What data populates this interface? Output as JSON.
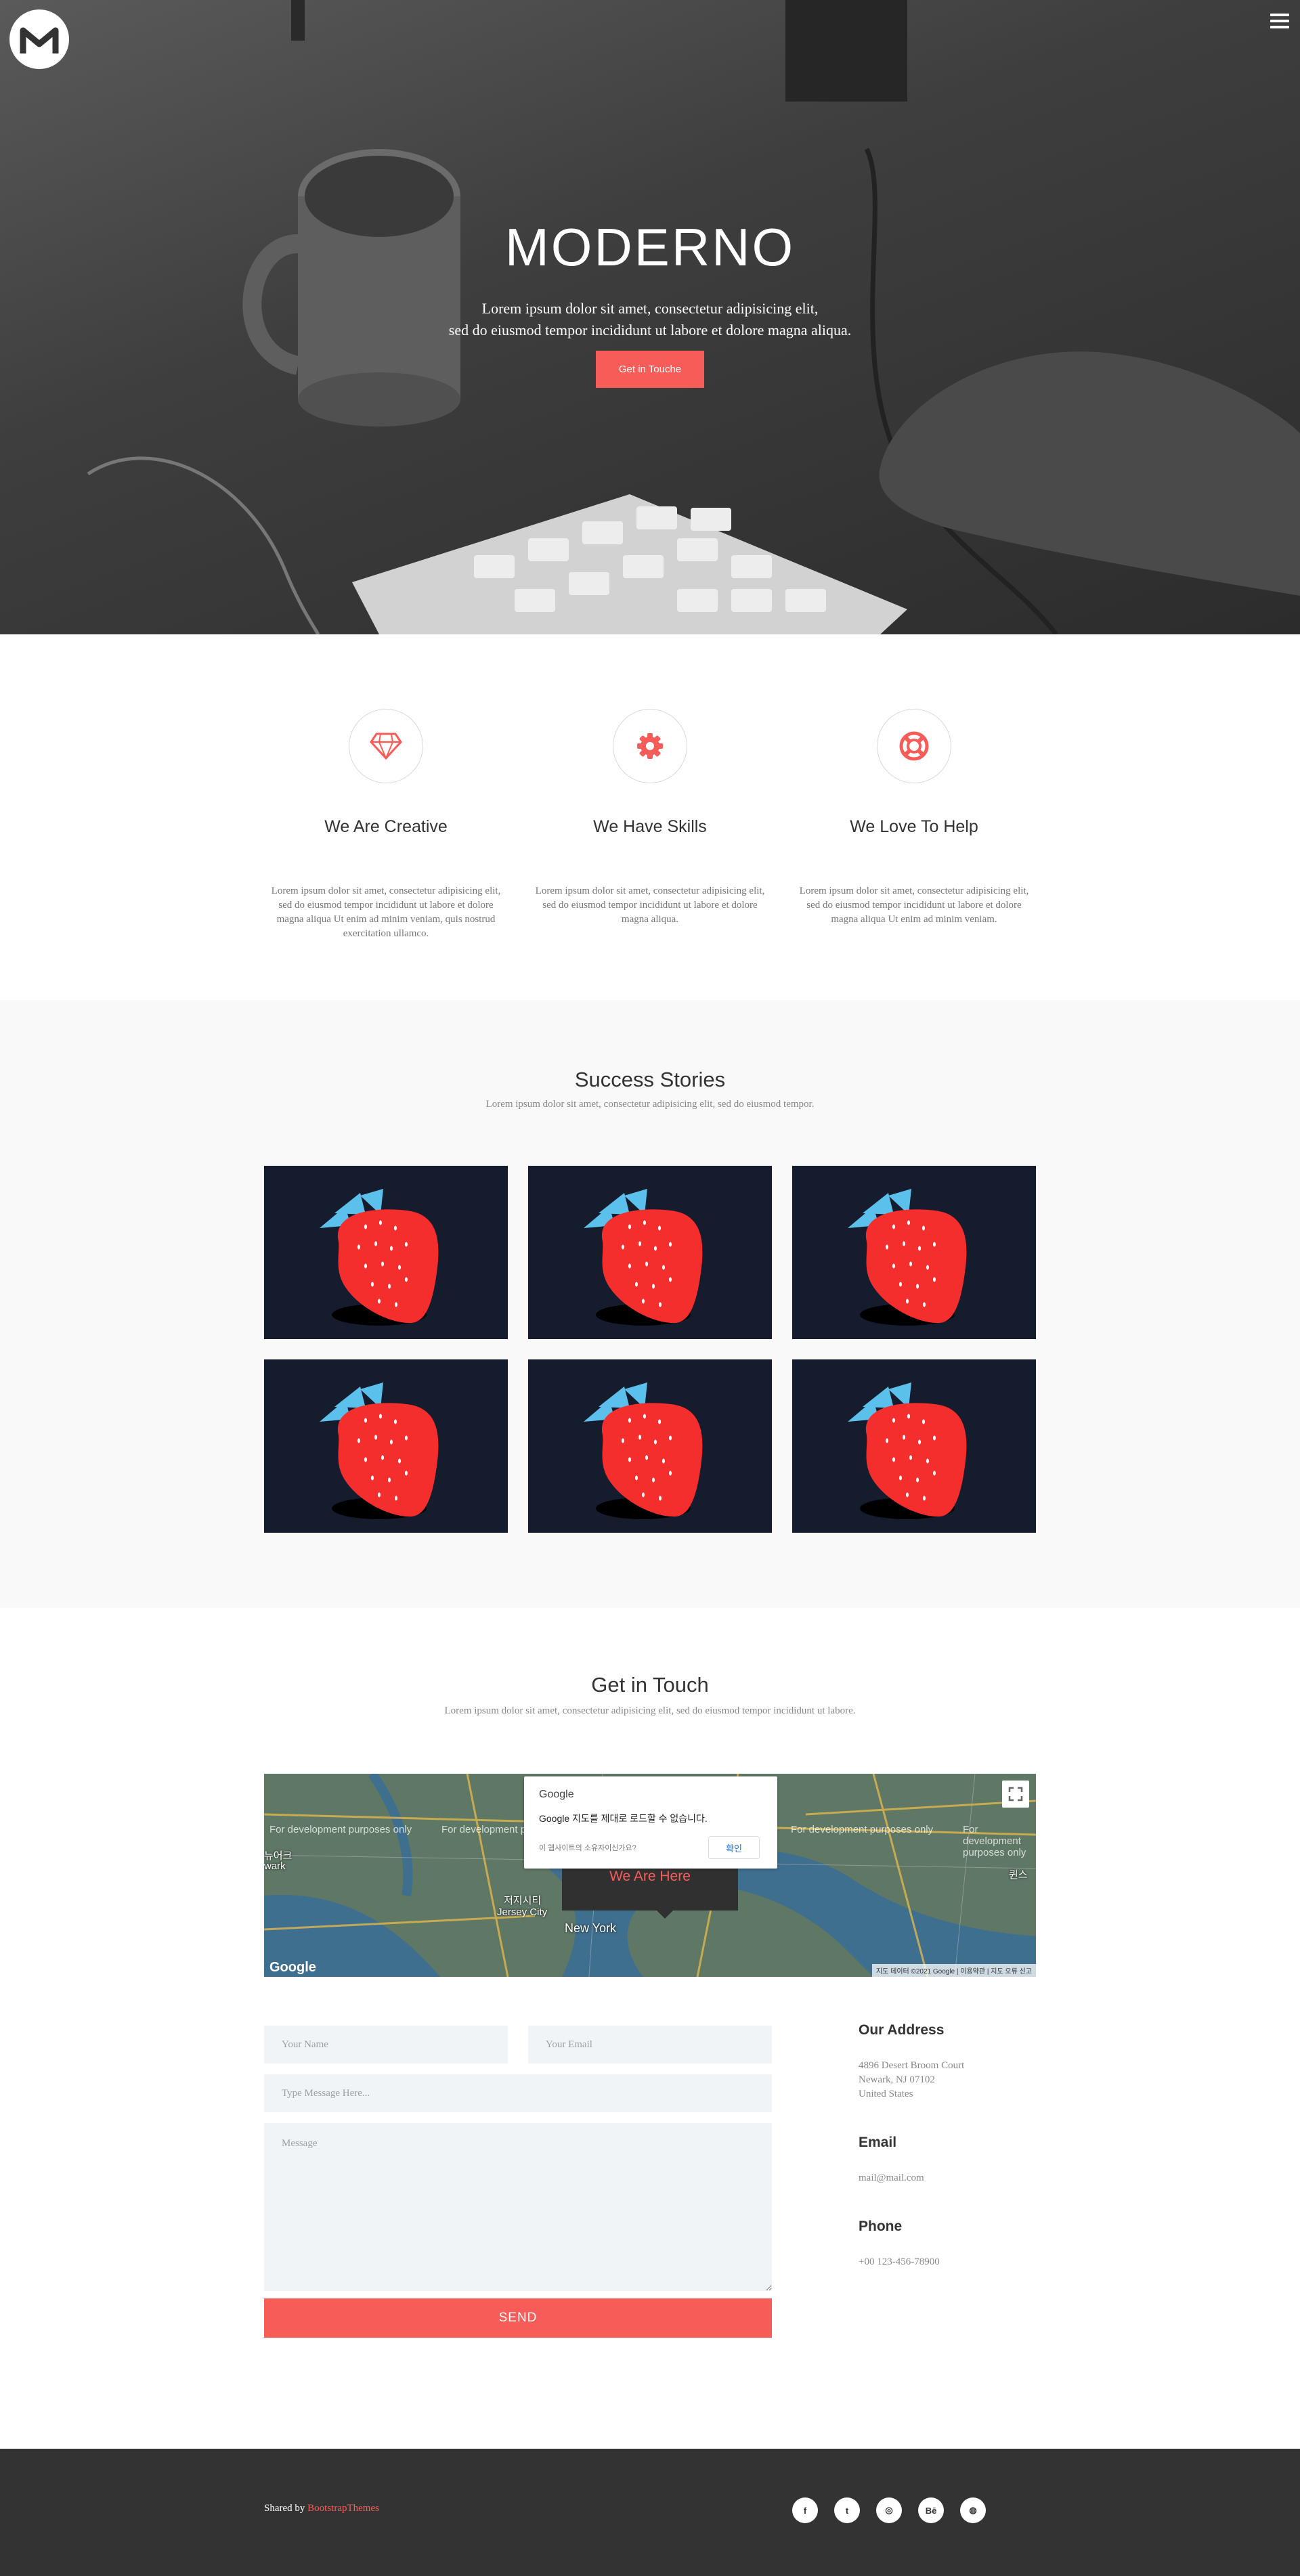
{
  "hero": {
    "title": "MODERNO",
    "line1": "Lorem ipsum dolor sit amet, consectetur adipisicing elit,",
    "line2": "sed do eiusmod tempor incididunt ut labore et dolore magna aliqua.",
    "button": "Get in Touche",
    "menu_icon": "hamburger-icon",
    "logo_icon": "m-logo-icon"
  },
  "features": [
    {
      "icon": "diamond-icon",
      "title": "We Are Creative",
      "text": "Lorem ipsum dolor sit amet, consectetur adipisicing elit, sed do eiusmod tempor incididunt ut labore et dolore magna aliqua Ut enim ad minim veniam, quis nostrud exercitation ullamco."
    },
    {
      "icon": "gear-icon",
      "title": "We Have Skills",
      "text": "Lorem ipsum dolor sit amet, consectetur adipisicing elit, sed do eiusmod tempor incididunt ut labore et dolore magna aliqua."
    },
    {
      "icon": "lifebuoy-icon",
      "title": "We Love To Help",
      "text": "Lorem ipsum dolor sit amet, consectetur adipisicing elit, sed do eiusmod tempor incididunt ut labore et dolore magna aliqua Ut enim ad minim veniam."
    }
  ],
  "stories": {
    "title": "Success Stories",
    "subtitle": "Lorem ipsum dolor sit amet, consectetur adipisicing elit, sed do eiusmod tempor.",
    "tile_icon": "strawberry-icon"
  },
  "contact": {
    "title": "Get in Touch",
    "subtitle": "Lorem ipsum dolor sit amet, consectetur adipisicing elit, sed do eiusmod tempor incididunt ut labore.",
    "map": {
      "dialog_brand": "Google",
      "dialog_message": "Google 지도를 제대로 로드할 수 없습니다.",
      "dialog_question": "이 웹사이트의 소유자이신가요?",
      "dialog_ok": "확인",
      "popup": "We Are Here",
      "dev_text": "For development purposes only",
      "logo": "Google",
      "attribution": "지도 데이터 ©2021 Google | 이용약관 | 지도 오류 신고",
      "cities": [
        "New York",
        "저지시티",
        "Jersey City",
        "뉴어크",
        "wark",
        "퀸스"
      ]
    },
    "form": {
      "name_placeholder": "Your Name",
      "email_placeholder": "Your Email",
      "subject_placeholder": "Type Message Here...",
      "message_placeholder": "Message",
      "send": "SEND"
    },
    "address": {
      "heading": "Our Address",
      "line1": "4896 Desert Broom Court",
      "line2": "Newark, NJ 07102",
      "line3": "United States"
    },
    "email": {
      "heading": "Email",
      "value": "mail@mail.com"
    },
    "phone": {
      "heading": "Phone",
      "value": "+00 123-456-78900"
    }
  },
  "footer": {
    "shared_prefix": "Shared by ",
    "shared_link": "BootstrapThemes",
    "social": [
      {
        "icon": "facebook-icon",
        "glyph": "f"
      },
      {
        "icon": "twitter-icon",
        "glyph": "t"
      },
      {
        "icon": "instagram-icon",
        "glyph": "◎"
      },
      {
        "icon": "behance-icon",
        "glyph": "Bē"
      },
      {
        "icon": "dribbble-icon",
        "glyph": "◍"
      }
    ]
  },
  "colors": {
    "accent": "#f85c58",
    "dark": "#333333",
    "tile_bg": "#151c2d",
    "strawberry": "#f42d2d",
    "leaf": "#5bc0eb"
  }
}
